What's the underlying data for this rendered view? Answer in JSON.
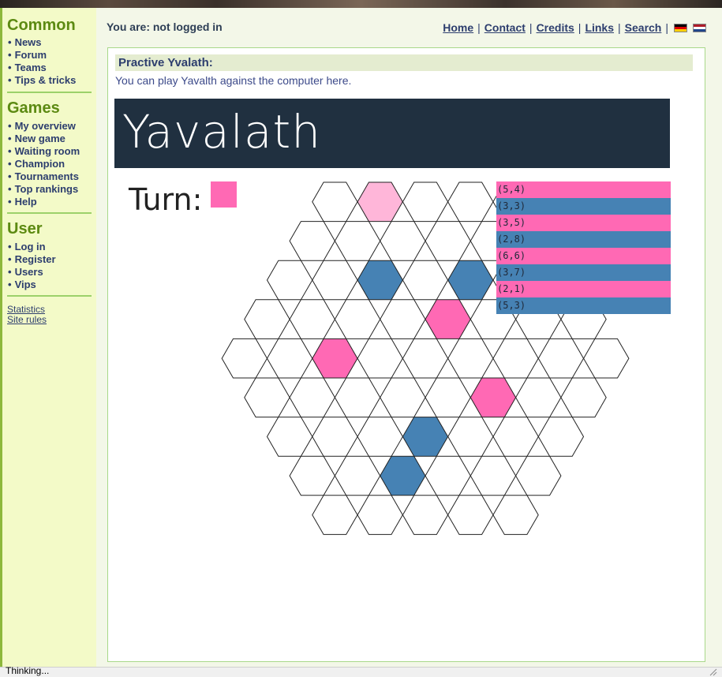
{
  "sidebar": {
    "sections": [
      {
        "title": "Common",
        "items": [
          "News",
          "Forum",
          "Teams",
          "Tips & tricks"
        ]
      },
      {
        "title": "Games",
        "items": [
          "My overview",
          "New game",
          "Waiting room",
          "Champion",
          "Tournaments",
          "Top rankings",
          "Help"
        ]
      },
      {
        "title": "User",
        "items": [
          "Log in",
          "Register",
          "Users",
          "Vips"
        ]
      }
    ],
    "footer_links": [
      "Statistics",
      "Site rules"
    ]
  },
  "header": {
    "login_status": "You are: not logged in",
    "nav": [
      "Home",
      "Contact",
      "Credits",
      "Links",
      "Search"
    ],
    "flags": [
      "german-flag-icon",
      "dutch-flag-icon"
    ]
  },
  "content": {
    "title": "Practive Yvalath:",
    "description": "You can play Yavalth against the computer here.",
    "banner_title": "Yavalath",
    "turn_label": "Turn:",
    "turn_color": "#ff69b4"
  },
  "colors": {
    "pink": "#ff69b4",
    "blue": "#4682b4",
    "highlight": "#ffb6d9",
    "sidebar_bg": "#f3fac8",
    "banner_bg": "#203040"
  },
  "board": {
    "rows": [
      [
        "empty",
        "highlight",
        "empty",
        "empty",
        "empty"
      ],
      [
        "empty",
        "empty",
        "empty",
        "empty",
        "empty",
        "empty"
      ],
      [
        "empty",
        "empty",
        "blue",
        "empty",
        "blue",
        "empty",
        "empty"
      ],
      [
        "empty",
        "empty",
        "empty",
        "empty",
        "pink",
        "empty",
        "empty",
        "empty"
      ],
      [
        "empty",
        "empty",
        "pink",
        "empty",
        "empty",
        "empty",
        "empty",
        "empty",
        "empty"
      ],
      [
        "empty",
        "empty",
        "empty",
        "empty",
        "empty",
        "pink",
        "empty",
        "empty"
      ],
      [
        "empty",
        "empty",
        "empty",
        "blue",
        "empty",
        "empty",
        "empty"
      ],
      [
        "empty",
        "empty",
        "blue",
        "empty",
        "empty",
        "empty"
      ],
      [
        "empty",
        "empty",
        "empty",
        "empty",
        "empty"
      ]
    ]
  },
  "moves": [
    {
      "label": "(5,4)",
      "color": "pink"
    },
    {
      "label": "(3,3)",
      "color": "blue"
    },
    {
      "label": "(3,5)",
      "color": "pink"
    },
    {
      "label": "(2,8)",
      "color": "blue"
    },
    {
      "label": "(6,6)",
      "color": "pink"
    },
    {
      "label": "(3,7)",
      "color": "blue"
    },
    {
      "label": "(2,1)",
      "color": "pink"
    },
    {
      "label": "(5,3)",
      "color": "blue"
    }
  ],
  "status_bar": {
    "text": "Thinking..."
  }
}
